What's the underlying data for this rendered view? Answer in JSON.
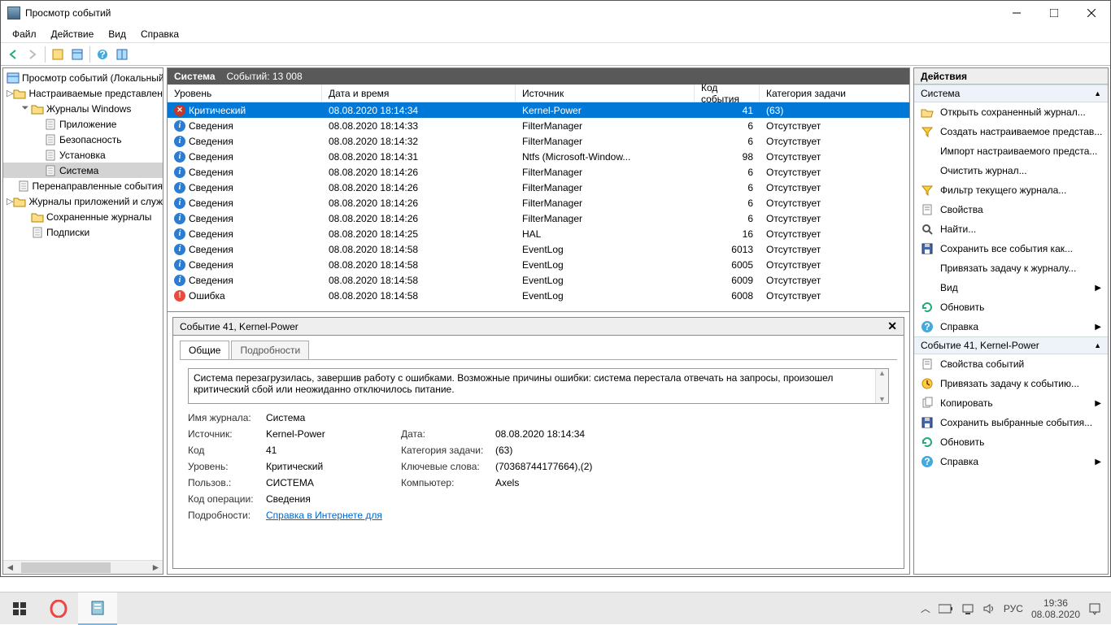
{
  "window": {
    "title": "Просмотр событий"
  },
  "menu": {
    "file": "Файл",
    "action": "Действие",
    "view": "Вид",
    "help": "Справка"
  },
  "tree": {
    "root": "Просмотр событий (Локальный)",
    "custom": "Настраиваемые представления",
    "winlogs": "Журналы Windows",
    "app": "Приложение",
    "sec": "Безопасность",
    "setup": "Установка",
    "system": "Система",
    "fwd": "Перенаправленные события",
    "applogs": "Журналы приложений и служб",
    "saved": "Сохраненные журналы",
    "subs": "Подписки"
  },
  "list": {
    "title": "Система",
    "count_label": "Событий: 13 008",
    "cols": {
      "level": "Уровень",
      "date": "Дата и время",
      "source": "Источник",
      "id": "Код события",
      "cat": "Категория задачи"
    },
    "rows": [
      {
        "lv": "crit",
        "level": "Критический",
        "date": "08.08.2020 18:14:34",
        "src": "Kernel-Power",
        "id": "41",
        "cat": "(63)",
        "sel": true
      },
      {
        "lv": "info",
        "level": "Сведения",
        "date": "08.08.2020 18:14:33",
        "src": "FilterManager",
        "id": "6",
        "cat": "Отсутствует"
      },
      {
        "lv": "info",
        "level": "Сведения",
        "date": "08.08.2020 18:14:32",
        "src": "FilterManager",
        "id": "6",
        "cat": "Отсутствует"
      },
      {
        "lv": "info",
        "level": "Сведения",
        "date": "08.08.2020 18:14:31",
        "src": "Ntfs (Microsoft-Window...",
        "id": "98",
        "cat": "Отсутствует"
      },
      {
        "lv": "info",
        "level": "Сведения",
        "date": "08.08.2020 18:14:26",
        "src": "FilterManager",
        "id": "6",
        "cat": "Отсутствует"
      },
      {
        "lv": "info",
        "level": "Сведения",
        "date": "08.08.2020 18:14:26",
        "src": "FilterManager",
        "id": "6",
        "cat": "Отсутствует"
      },
      {
        "lv": "info",
        "level": "Сведения",
        "date": "08.08.2020 18:14:26",
        "src": "FilterManager",
        "id": "6",
        "cat": "Отсутствует"
      },
      {
        "lv": "info",
        "level": "Сведения",
        "date": "08.08.2020 18:14:26",
        "src": "FilterManager",
        "id": "6",
        "cat": "Отсутствует"
      },
      {
        "lv": "info",
        "level": "Сведения",
        "date": "08.08.2020 18:14:25",
        "src": "HAL",
        "id": "16",
        "cat": "Отсутствует"
      },
      {
        "lv": "info",
        "level": "Сведения",
        "date": "08.08.2020 18:14:58",
        "src": "EventLog",
        "id": "6013",
        "cat": "Отсутствует"
      },
      {
        "lv": "info",
        "level": "Сведения",
        "date": "08.08.2020 18:14:58",
        "src": "EventLog",
        "id": "6005",
        "cat": "Отсутствует"
      },
      {
        "lv": "info",
        "level": "Сведения",
        "date": "08.08.2020 18:14:58",
        "src": "EventLog",
        "id": "6009",
        "cat": "Отсутствует"
      },
      {
        "lv": "err",
        "level": "Ошибка",
        "date": "08.08.2020 18:14:58",
        "src": "EventLog",
        "id": "6008",
        "cat": "Отсутствует"
      }
    ]
  },
  "detail": {
    "title": "Событие 41, Kernel-Power",
    "tab_general": "Общие",
    "tab_details": "Подробности",
    "description": "Система перезагрузилась, завершив работу с ошибками. Возможные причины ошибки: система перестала отвечать на запросы, произошел критический сбой или неожиданно отключилось питание.",
    "labels": {
      "logname": "Имя журнала:",
      "source": "Источник:",
      "code": "Код",
      "level": "Уровень:",
      "user": "Пользов.:",
      "opcode": "Код операции:",
      "more": "Подробности:",
      "date": "Дата:",
      "cat": "Категория задачи:",
      "keywords": "Ключевые слова:",
      "computer": "Компьютер:"
    },
    "values": {
      "logname": "Система",
      "source": "Kernel-Power",
      "code": "41",
      "level": "Критический",
      "user": "СИСТЕМА",
      "opcode": "Сведения",
      "date": "08.08.2020 18:14:34",
      "cat": "(63)",
      "keywords": "(70368744177664),(2)",
      "computer": "Axels",
      "link": "Справка в Интернете для "
    }
  },
  "actions": {
    "header": "Действия",
    "sec1": "Система",
    "sec2": "Событие 41, Kernel-Power",
    "items1": [
      {
        "icon": "open",
        "label": "Открыть сохраненный журнал..."
      },
      {
        "icon": "filter",
        "label": "Создать настраиваемое представ..."
      },
      {
        "icon": "blank",
        "label": "Импорт настраиваемого предста..."
      },
      {
        "icon": "blank",
        "label": "Очистить журнал..."
      },
      {
        "icon": "filter",
        "label": "Фильтр текущего журнала..."
      },
      {
        "icon": "props",
        "label": "Свойства"
      },
      {
        "icon": "find",
        "label": "Найти..."
      },
      {
        "icon": "save",
        "label": "Сохранить все события как..."
      },
      {
        "icon": "blank",
        "label": "Привязать задачу к журналу..."
      },
      {
        "icon": "blank",
        "label": "Вид",
        "sub": true
      },
      {
        "icon": "refresh",
        "label": "Обновить"
      },
      {
        "icon": "help",
        "label": "Справка",
        "sub": true
      }
    ],
    "items2": [
      {
        "icon": "props",
        "label": "Свойства событий"
      },
      {
        "icon": "task",
        "label": "Привязать задачу к событию..."
      },
      {
        "icon": "copy",
        "label": "Копировать",
        "sub": true
      },
      {
        "icon": "save",
        "label": "Сохранить выбранные события..."
      },
      {
        "icon": "refresh",
        "label": "Обновить"
      },
      {
        "icon": "help",
        "label": "Справка",
        "sub": true
      }
    ]
  },
  "taskbar": {
    "lang": "РУС",
    "time": "19:36",
    "date": "08.08.2020"
  }
}
